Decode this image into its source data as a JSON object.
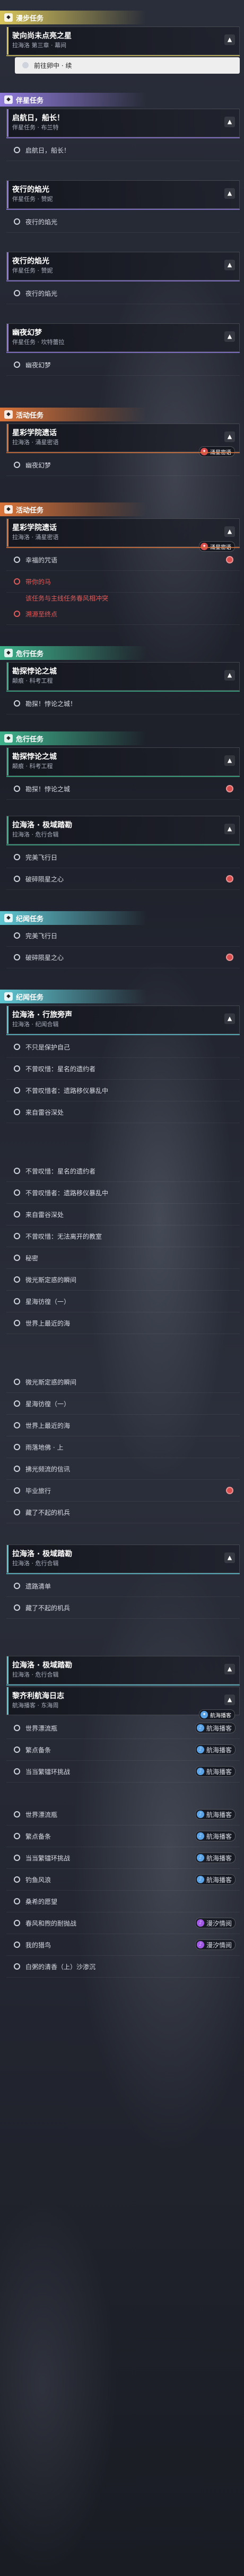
{
  "categories": {
    "zhuxian": {
      "label": "漫步任务",
      "color": "#d7c45b",
      "icon": "leaf-icon"
    },
    "banxing": {
      "label": "伴星任务",
      "color": "#8f7ad9",
      "icon": "star-icon"
    },
    "huodong": {
      "label": "活动任务",
      "color": "#d9743a",
      "icon": "flame-icon"
    },
    "huoyue": {
      "label": "危行任务",
      "color": "#3eb08a",
      "icon": "pulse-icon"
    },
    "jiwen": {
      "label": "纪闻任务",
      "color": "#5fc6d1",
      "icon": "scroll-icon"
    }
  },
  "sections": [
    {
      "cat": "zhuxian",
      "header": "漫步任务",
      "cards": [
        {
          "title": "驶向尚未点亮之星",
          "sub": "拉海洛 第三章 · 幕间",
          "expanded": true
        }
      ],
      "objectives": [
        {
          "text": "前往卵中 · 续",
          "state": "highlight"
        }
      ]
    },
    {
      "cat": "banxing",
      "header": "伴星任务",
      "cards": [
        {
          "title": "启航日，船长！",
          "sub": "伴星任务 · 布兰特",
          "expanded": true
        }
      ],
      "objectives": [
        {
          "text": "启航日，船长！",
          "state": "open"
        }
      ]
    },
    {
      "cat": "banxing",
      "header": "",
      "cards": [
        {
          "title": "夜行的焰光",
          "sub": "伴星任务 · 赞妮",
          "expanded": true
        }
      ],
      "objectives": [
        {
          "text": "夜行的焰光",
          "state": "open"
        }
      ]
    },
    {
      "cat": "banxing",
      "header": "",
      "cards": [
        {
          "title": "夜行的焰光",
          "sub": "伴星任务 · 赞妮",
          "expanded": true
        }
      ],
      "objectives": [
        {
          "text": "夜行的焰光",
          "state": "open"
        }
      ]
    },
    {
      "cat": "banxing",
      "header": "",
      "cards": [
        {
          "title": "幽夜幻梦",
          "sub": "伴星任务 · 坎特蕾拉",
          "expanded": true
        }
      ],
      "objectives": [
        {
          "text": "幽夜幻梦",
          "state": "open"
        }
      ]
    },
    {
      "cat": "huodong",
      "header": "活动任务",
      "cards": [
        {
          "title": "星彩学院遗话",
          "sub": "拉海洛 · 涌星密语",
          "expanded": true,
          "badge": {
            "text": "涌星密语",
            "type": "red"
          }
        }
      ],
      "objectives": [
        {
          "text": "幽夜幻梦",
          "state": "open"
        }
      ]
    },
    {
      "cat": "huodong",
      "header": "活动任务",
      "cards": [
        {
          "title": "星彩学院遗话",
          "sub": "拉海洛 · 涌星密语",
          "expanded": true,
          "badge": {
            "text": "涌星密语",
            "type": "red"
          }
        }
      ],
      "objectives": [
        {
          "text": "幸福的咒语",
          "state": "open",
          "pin": true
        },
        {
          "text": "带你的马",
          "state": "red"
        },
        {
          "text": "该任务与主线任务春风相冲突",
          "state": "red-note"
        },
        {
          "text": "溯源至终点",
          "state": "red"
        }
      ]
    },
    {
      "cat": "huoyue",
      "header": "危行任务",
      "cards": [
        {
          "title": "勘探悖论之城",
          "sub": "颠痕 · 科考工程",
          "expanded": true
        }
      ],
      "objectives": [
        {
          "text": "勘探！悖论之城！",
          "state": "open"
        }
      ]
    },
    {
      "cat": "huoyue",
      "header": "危行任务",
      "cards": [
        {
          "title": "勘探悖论之城",
          "sub": "颠痕 · 科考工程",
          "expanded": true
        }
      ],
      "objectives": [
        {
          "text": "勘探！悖论之城",
          "state": "open",
          "pin": true
        }
      ]
    },
    {
      "cat": "huoyue",
      "header": "",
      "cards": [
        {
          "title": "拉海洛 · 极域踏勘",
          "sub": "拉海洛 · 危行合辑",
          "expanded": true
        }
      ],
      "objectives": [
        {
          "text": "完美飞行日",
          "state": "open"
        },
        {
          "text": "破碎陨星之心",
          "state": "open",
          "pin": true
        }
      ]
    },
    {
      "cat": "jiwen",
      "header": "纪闻任务",
      "cards": [],
      "objectives": [
        {
          "text": "完美飞行日",
          "state": "open"
        },
        {
          "text": "破碎陨星之心",
          "state": "open",
          "pin": true
        }
      ]
    },
    {
      "cat": "jiwen",
      "header": "纪闻任务",
      "cards": [
        {
          "title": "拉海洛 · 行旅旁声",
          "sub": "拉海洛 · 纪闻合辑",
          "expanded": true
        }
      ],
      "objectives": [
        {
          "text": "不只是保护自己",
          "state": "open"
        },
        {
          "text": "不曾叹惜：星名的遗约者",
          "state": "open"
        },
        {
          "text": "不曾叹惜者：遗路移仪暴乱中",
          "state": "open"
        },
        {
          "text": "来自雷谷深处",
          "state": "open"
        }
      ]
    },
    {
      "cat": "jiwen",
      "header": "",
      "cards": [],
      "objectives": [
        {
          "text": "不曾叹惜：星名的遗约者",
          "state": "open"
        },
        {
          "text": "不曾叹惜者：遗路移仪暴乱中",
          "state": "open"
        },
        {
          "text": "来自雷谷深处",
          "state": "open"
        },
        {
          "text": "不曾叹惜：无法离开的教室",
          "state": "open"
        },
        {
          "text": "秘密",
          "state": "open"
        },
        {
          "text": "微光斯定惑的瞬间",
          "state": "open"
        },
        {
          "text": "星海彷徨（一）",
          "state": "open"
        },
        {
          "text": "世界上最近的海",
          "state": "open"
        }
      ]
    },
    {
      "cat": "jiwen",
      "header": "",
      "cards": [],
      "objectives": [
        {
          "text": "微光斯定惑的瞬间",
          "state": "open"
        },
        {
          "text": "星海彷徨（一）",
          "state": "open"
        },
        {
          "text": "世界上最近的海",
          "state": "open"
        },
        {
          "text": "雨落地佛 · 上",
          "state": "open"
        },
        {
          "text": "拂光频流的信讯",
          "state": "open"
        },
        {
          "text": "毕业旅行",
          "state": "open",
          "pin": true
        },
        {
          "text": "藏了不起的机兵",
          "state": "open"
        }
      ]
    },
    {
      "cat": "jiwen",
      "header": "",
      "cards": [
        {
          "title": "拉海洛 · 极域踏勘",
          "sub": "拉海洛 · 危行合辑",
          "expanded": true
        }
      ],
      "objectives": [
        {
          "text": "遗路清单",
          "state": "open"
        },
        {
          "text": "藏了不起的机兵",
          "state": "open"
        }
      ]
    },
    {
      "cat": "jiwen",
      "header": "",
      "cards": [
        {
          "title": "拉海洛 · 极域踏勘",
          "sub": "拉海洛 · 危行合辑",
          "expanded": true
        },
        {
          "title": "黎齐利航海日志",
          "sub": "航海播客 · 东海周",
          "expanded": true,
          "badge": {
            "text": "航海播客",
            "type": "blue"
          }
        }
      ],
      "objectives": [
        {
          "text": "世界漂流瓶",
          "state": "open",
          "badge": {
            "text": "航海播客",
            "type": "blue"
          }
        },
        {
          "text": "繁点备条",
          "state": "open",
          "badge": {
            "text": "航海播客",
            "type": "blue"
          }
        },
        {
          "text": "当当繁镭环挑战",
          "state": "open",
          "badge": {
            "text": "航海播客",
            "type": "blue"
          }
        }
      ]
    },
    {
      "cat": "jiwen",
      "header": "",
      "cards": [],
      "objectives": [
        {
          "text": "世界漂流瓶",
          "state": "open",
          "badge": {
            "text": "航海播客",
            "type": "blue"
          }
        },
        {
          "text": "繁点备条",
          "state": "open",
          "badge": {
            "text": "航海播客",
            "type": "blue"
          }
        },
        {
          "text": "当当繁镭环挑战",
          "state": "open",
          "badge": {
            "text": "航海播客",
            "type": "blue"
          }
        },
        {
          "text": "钓鱼风浪",
          "state": "open",
          "badge": {
            "text": "航海播客",
            "type": "blue"
          }
        },
        {
          "text": "桑希的愿望",
          "state": "open"
        },
        {
          "text": "春风和煦的耐抛战",
          "state": "open",
          "badge": {
            "text": "漫汐情阅",
            "type": "purple"
          }
        },
        {
          "text": "我的猎鸟",
          "state": "open",
          "badge": {
            "text": "漫汐情阅",
            "type": "purple"
          }
        },
        {
          "text": "白粥的清香（上）沙渗沉",
          "state": "open"
        }
      ]
    }
  ]
}
